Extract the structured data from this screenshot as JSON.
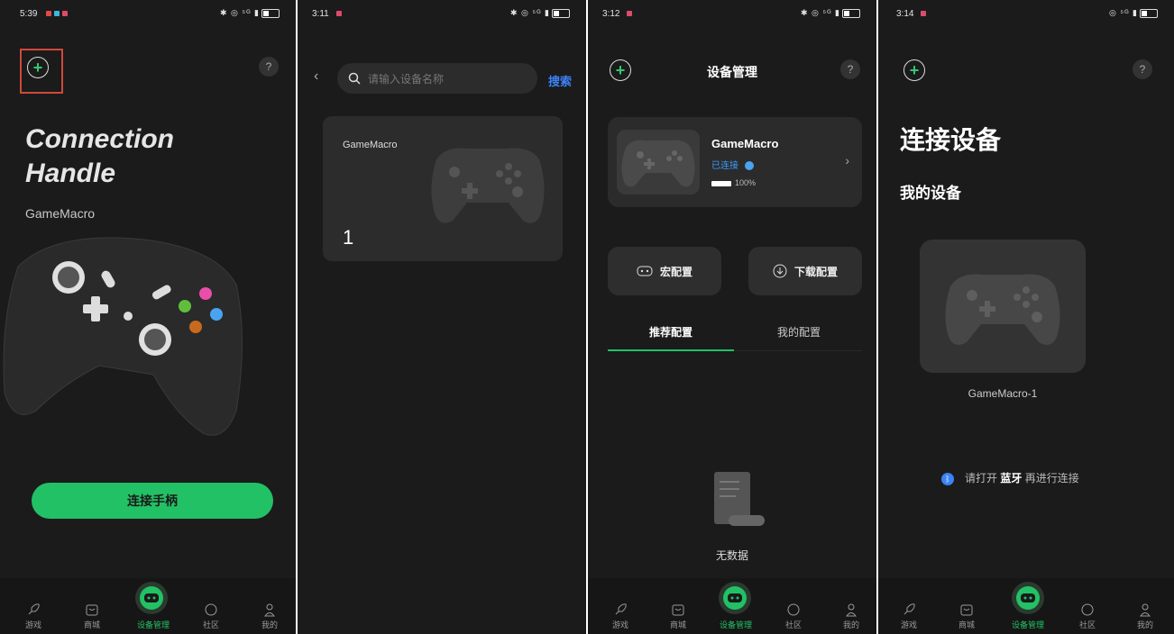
{
  "screens": [
    {
      "status": {
        "time": "5:39",
        "right": "✱ ◎ ⁵ᴳ ▮"
      },
      "hero_line1": "Connection",
      "hero_line2": "Handle",
      "device_name": "GameMacro",
      "help": "?",
      "connect_button": "连接手柄"
    },
    {
      "status": {
        "time": "3:11",
        "right": "✱ ◎ ⁵ᴳ ▮"
      },
      "search_placeholder": "请输入设备名称",
      "search_label": "搜索",
      "device": {
        "name": "GameMacro",
        "count": "1"
      }
    },
    {
      "status": {
        "time": "3:12",
        "right": "✱ ◎ ⁵ᴳ ▮"
      },
      "title": "设备管理",
      "help": "?",
      "device": {
        "name": "GameMacro",
        "status": "已连接",
        "battery": "100%"
      },
      "macro_config": "宏配置",
      "download_config": "下载配置",
      "tabs": [
        "推荐配置",
        "我的配置"
      ],
      "empty": "无数据"
    },
    {
      "status": {
        "time": "3:14",
        "right": "◎ ⁵ᴳ ▮"
      },
      "title": "连接设备",
      "subtitle": "我的设备",
      "help": "?",
      "device_label": "GameMacro-1",
      "hint_pre": "请打开",
      "hint_bold": "蓝牙",
      "hint_post": "再进行连接"
    }
  ],
  "tabbar": {
    "items": [
      "游戏",
      "商城",
      "设备管理",
      "社区",
      "我的"
    ]
  },
  "colors": {
    "accent": "#22c165",
    "link": "#3b82f6",
    "highlight": "#d0493b"
  }
}
